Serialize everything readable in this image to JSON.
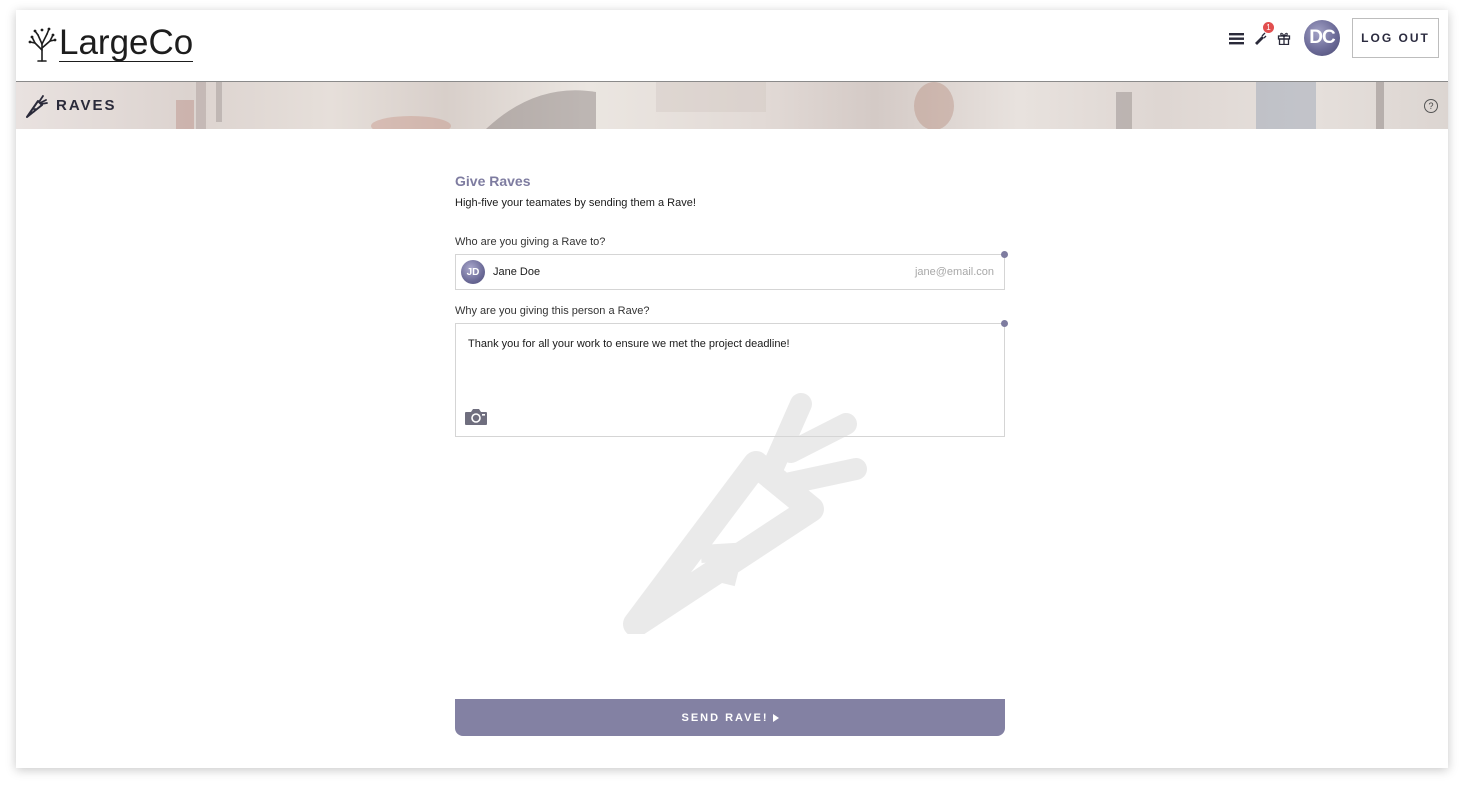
{
  "header": {
    "logo_text": "LargeCo",
    "notification_count": "1",
    "user_initials": "DC",
    "logout_label": "LOG OUT",
    "icons": [
      "menu-icon",
      "notification-icon",
      "gift-icon"
    ]
  },
  "banner": {
    "title": "RAVES",
    "help_symbol": "?"
  },
  "form": {
    "title": "Give Raves",
    "subtitle": "High-five your teamates by sending them a Rave!",
    "recipient_label": "Who are you giving a Rave to?",
    "recipient": {
      "initials": "JD",
      "name": "Jane Doe",
      "email": "jane@email.con"
    },
    "message_label": "Why are you giving this person a Rave?",
    "message_value": "Thank you for all your work to ensure we met the project deadline!",
    "send_label": "SEND RAVE!"
  },
  "colors": {
    "accent": "#8381a3",
    "title": "#7e7ca0",
    "badge": "#e14e4e"
  }
}
